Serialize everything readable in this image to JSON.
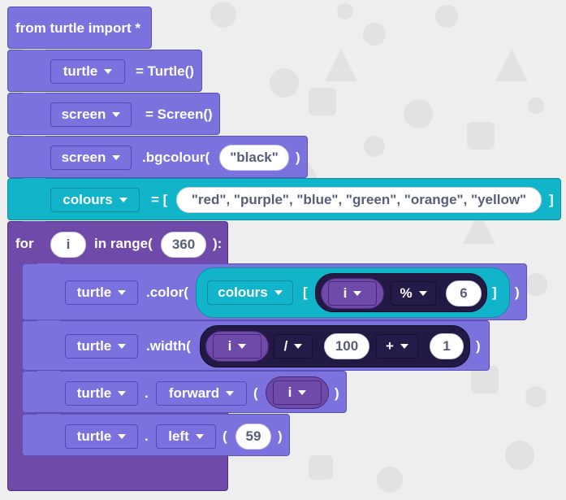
{
  "line1": {
    "text": "from turtle import *"
  },
  "line2": {
    "var": "turtle",
    "text": "= Turtle()"
  },
  "line3": {
    "var": "screen",
    "text": "= Screen()"
  },
  "line4": {
    "var": "screen",
    "method": ".bgcolour(",
    "arg": "\"black\"",
    "close": ")"
  },
  "line5": {
    "var": "colours",
    "eq": "= [",
    "list": "\"red\", \"purple\", \"blue\", \"green\", \"orange\", \"yellow\"",
    "close": "]"
  },
  "loop": {
    "for": "for",
    "var": "i",
    "inrange": "in range(",
    "count": "360",
    "close": "):"
  },
  "line7": {
    "var": "turtle",
    "method": ".color(",
    "listvar": "colours",
    "open_br": "[",
    "i": "i",
    "op": "%",
    "num": "6",
    "close_br": "]",
    "close": ")"
  },
  "line8": {
    "var": "turtle",
    "method": ".width(",
    "i": "i",
    "op1": "/",
    "num1": "100",
    "op2": "+",
    "num2": "1",
    "close": ")"
  },
  "line9": {
    "var": "turtle",
    "dot": ".",
    "method": "forward",
    "open": "(",
    "arg": "i",
    "close": ")"
  },
  "line10": {
    "var": "turtle",
    "dot": ".",
    "method": "left",
    "open": "(",
    "arg": "59",
    "close": ")"
  },
  "colors": {
    "block_purple": "#7b72dd",
    "block_cyan": "#12b4c9",
    "loop_purple": "#6f4aa8",
    "navy": "#241b48",
    "background": "#eeeeee",
    "pill_text": "#575e75"
  },
  "icons": [
    "caret-down-icon"
  ]
}
